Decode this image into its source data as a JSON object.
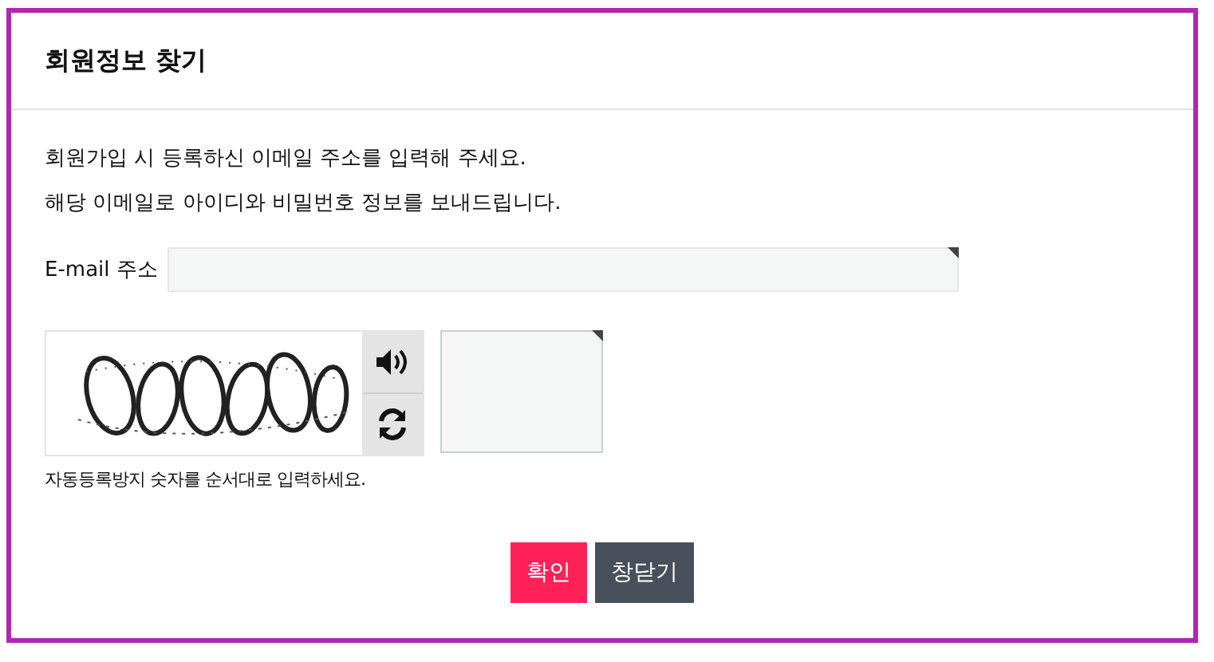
{
  "dialog": {
    "title": "회원정보 찾기"
  },
  "intro": [
    "회원가입 시 등록하신 이메일 주소를 입력해 주세요.",
    "해당 이메일로 아이디와 비밀번호 정보를 보내드립니다."
  ],
  "email": {
    "label": "E-mail 주소"
  },
  "captcha": {
    "hint": "자동등록방지 숫자를 순서대로 입력하세요."
  },
  "buttons": [
    {
      "label": "확인",
      "kind": "primary"
    },
    {
      "label": "창닫기",
      "kind": "secondary"
    }
  ]
}
